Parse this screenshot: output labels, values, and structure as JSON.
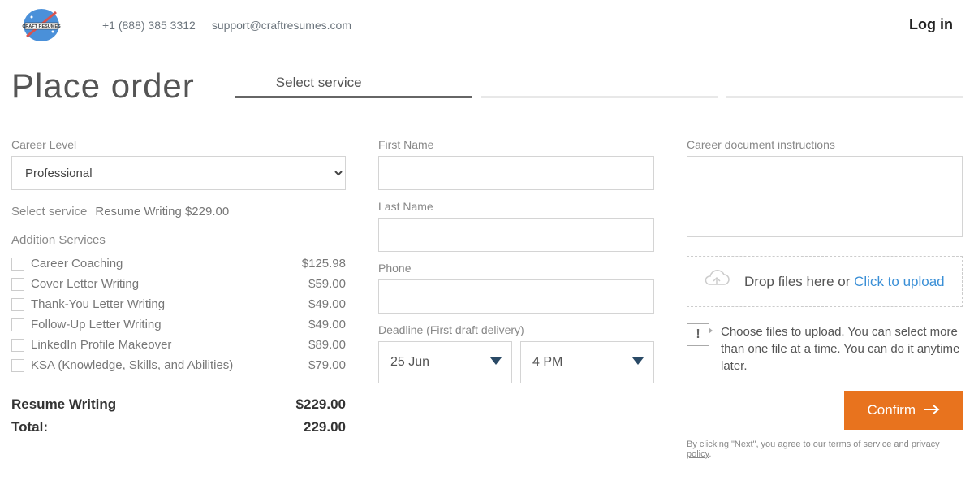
{
  "header": {
    "phone": "+1 (888) 385 3312",
    "email": "support@craftresumes.com",
    "login": "Log in",
    "logo": "CRAFT RESUMES"
  },
  "page": {
    "title": "Place order",
    "step_label": "Select service"
  },
  "form": {
    "career_level_label": "Career Level",
    "career_level_value": "Professional",
    "select_service_label": "Select service",
    "select_service_value": "Resume Writing $229.00",
    "addition_services_label": "Addition Services",
    "addons": [
      {
        "name": "Career Coaching",
        "price": "$125.98"
      },
      {
        "name": "Cover Letter Writing",
        "price": "$59.00"
      },
      {
        "name": "Thank-You Letter Writing",
        "price": "$49.00"
      },
      {
        "name": "Follow-Up Letter Writing",
        "price": "$49.00"
      },
      {
        "name": "LinkedIn Profile Makeover",
        "price": "$89.00"
      },
      {
        "name": "KSA (Knowledge, Skills, and Abilities)",
        "price": "$79.00"
      }
    ],
    "summary_item_name": "Resume Writing",
    "summary_item_price": "$229.00",
    "total_label": "Total:",
    "total_price": "229.00",
    "first_name_label": "First Name",
    "last_name_label": "Last Name",
    "phone_label": "Phone",
    "deadline_label": "Deadline (First draft delivery)",
    "deadline_date": "25 Jun",
    "deadline_time": "4 PM",
    "instructions_label": "Career document instructions",
    "drop_text": "Drop files here or ",
    "drop_link": "Click to upload",
    "info_text": "Choose files to upload. You can select more than one file at a time. You can do it anytime later.",
    "confirm_label": "Confirm",
    "terms_prefix": "By clicking \"Next\", you agree to our ",
    "terms_link1": "terms of service",
    "terms_and": " and ",
    "terms_link2": "privacy policy",
    "terms_suffix": "."
  }
}
